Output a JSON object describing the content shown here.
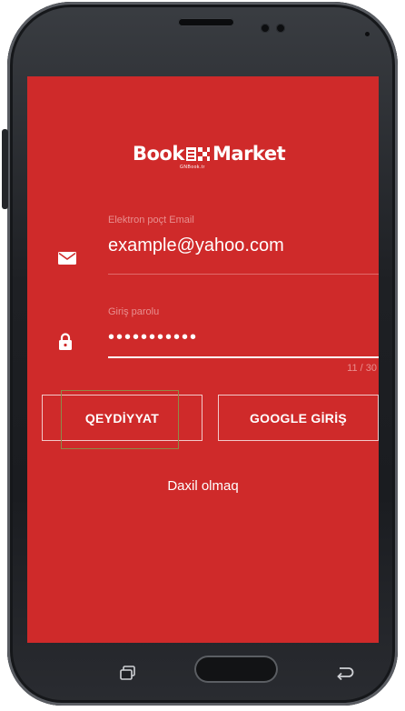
{
  "app": {
    "logo_left": "Book",
    "logo_right": "Market",
    "logo_sub": "GNBook.tr"
  },
  "form": {
    "email_label": "Elektron poçt Email",
    "email_value": "example@yahoo.com",
    "password_label": "Giriş parolu",
    "password_value": "•••••••••••",
    "password_counter": "11 / 30"
  },
  "buttons": {
    "register": "QEYDİYYAT",
    "google": "GOOGLE GİRİŞ",
    "signin_link": "Daxil olmaq"
  },
  "icons": {
    "email": "mail-icon",
    "password": "lock-icon",
    "recent": "recent-apps-icon",
    "back": "back-icon"
  },
  "colors": {
    "screen_background": "#cf2a2a",
    "text": "#ffffff",
    "hint_text": "#e88f8f",
    "button_border": "#f2c9c9"
  }
}
